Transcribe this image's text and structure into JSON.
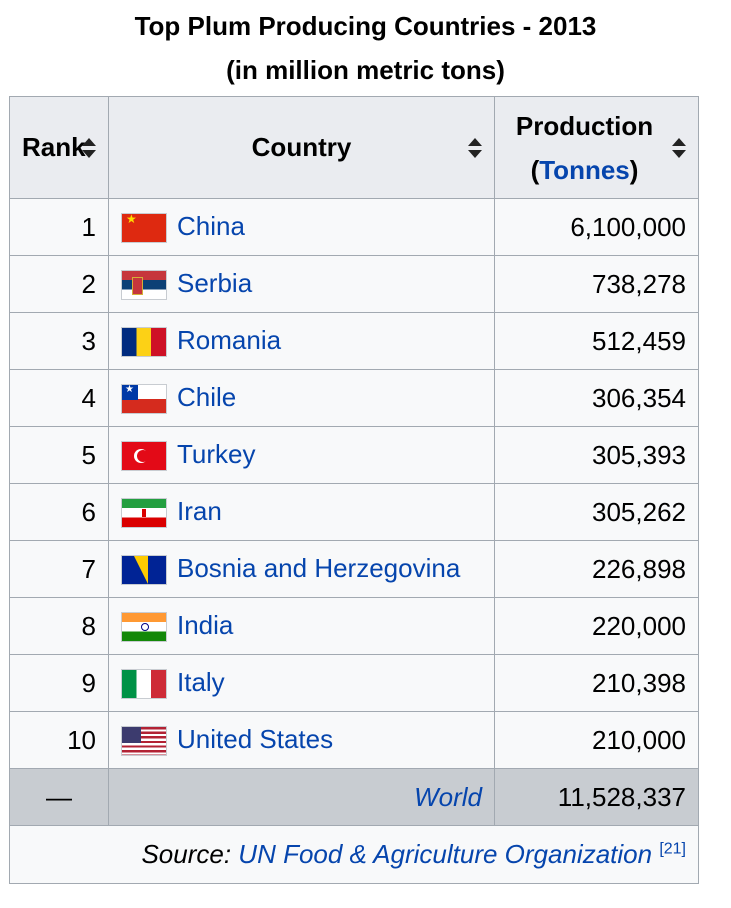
{
  "caption": {
    "line1": "Top Plum Producing Countries - 2013",
    "line2": "(in million metric tons)"
  },
  "header": {
    "rank": "Rank",
    "country": "Country",
    "production_line1": "Production",
    "production_open": "(",
    "production_unit": "Tonnes",
    "production_close": ")"
  },
  "rows": [
    {
      "rank": "1",
      "country": "China",
      "flag": "cn",
      "production": "6,100,000"
    },
    {
      "rank": "2",
      "country": "Serbia",
      "flag": "rs",
      "production": "738,278"
    },
    {
      "rank": "3",
      "country": "Romania",
      "flag": "ro",
      "production": "512,459"
    },
    {
      "rank": "4",
      "country": "Chile",
      "flag": "cl",
      "production": "306,354"
    },
    {
      "rank": "5",
      "country": "Turkey",
      "flag": "tr",
      "production": "305,393"
    },
    {
      "rank": "6",
      "country": "Iran",
      "flag": "ir",
      "production": "305,262"
    },
    {
      "rank": "7",
      "country": "Bosnia and Herzegovina",
      "flag": "ba",
      "production": "226,898"
    },
    {
      "rank": "8",
      "country": "India",
      "flag": "in",
      "production": "220,000"
    },
    {
      "rank": "9",
      "country": "Italy",
      "flag": "it",
      "production": "210,398"
    },
    {
      "rank": "10",
      "country": "United States",
      "flag": "us",
      "production": "210,000"
    }
  ],
  "world": {
    "rank": "—",
    "country": "World",
    "production": "11,528,337"
  },
  "source": {
    "prefix": "Source: ",
    "link": "UN Food & Agriculture Organization",
    "ref": "[21]"
  },
  "colors": {
    "link": "#0645ad",
    "header_bg": "#eaecf0",
    "world_bg": "#c8ccd1",
    "border": "#a2a9b1"
  }
}
